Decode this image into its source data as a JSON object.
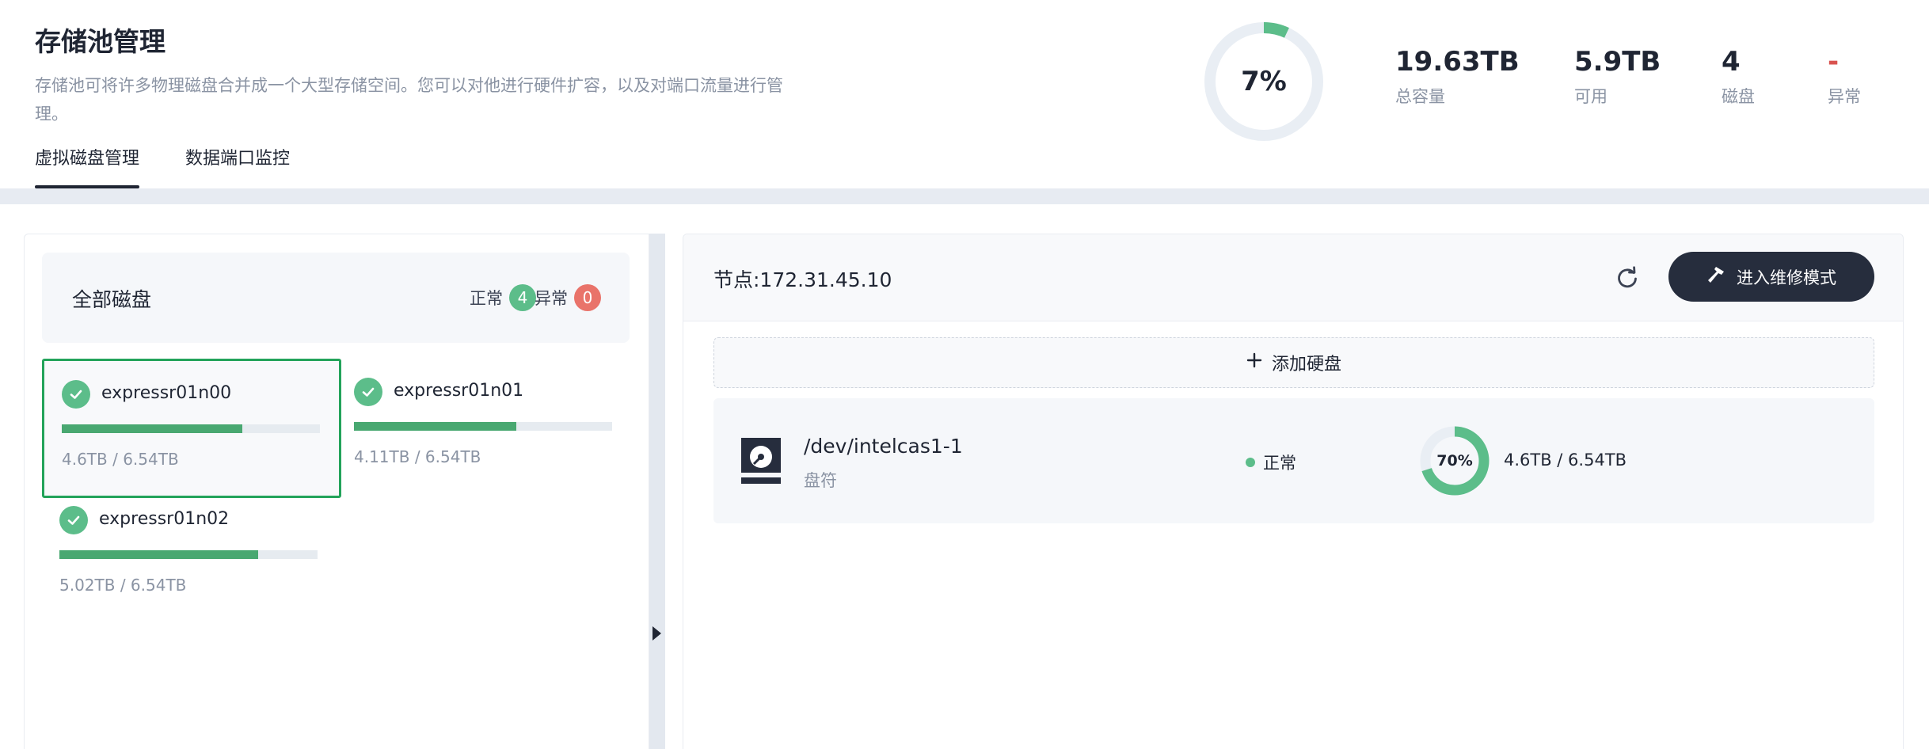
{
  "header": {
    "title": "存储池管理",
    "description": "存储池可将许多物理磁盘合并成一个大型存储空间。您可以对他进行硬件扩容，以及对端口流量进行管理。",
    "tabs": [
      {
        "label": "虚拟磁盘管理",
        "active": true
      },
      {
        "label": "数据端口监控",
        "active": false
      }
    ]
  },
  "summary": {
    "usage_percent_label": "7%",
    "usage_fraction": 0.07,
    "stats": [
      {
        "value": "19.63TB",
        "label": "总容量"
      },
      {
        "value": "5.9TB",
        "label": "可用"
      },
      {
        "value": "4",
        "label": "磁盘"
      },
      {
        "value": "-",
        "label": "异常"
      }
    ]
  },
  "disk_panel": {
    "title": "全部磁盘",
    "normal_label": "正常",
    "normal_count": "4",
    "abnormal_label": "异常",
    "abnormal_count": "0",
    "disks": [
      {
        "name": "expressr01n00",
        "usage": "4.6TB / 6.54TB",
        "fill": 0.7,
        "selected": true
      },
      {
        "name": "expressr01n01",
        "usage": "4.11TB / 6.54TB",
        "fill": 0.63,
        "selected": false
      },
      {
        "name": "expressr01n02",
        "usage": "5.02TB / 6.54TB",
        "fill": 0.77,
        "selected": false
      }
    ]
  },
  "detail_panel": {
    "node_label": "节点:172.31.45.10",
    "maintenance_button": "进入维修模式",
    "add_disk_label": "添加硬盘",
    "devices": [
      {
        "name": "/dev/intelcas1-1",
        "sub_label": "盘符",
        "status": "正常",
        "usage_percent_label": "70%",
        "usage_fraction": 0.7,
        "capacity": "4.6TB / 6.54TB"
      }
    ]
  },
  "colors": {
    "accent_green": "#5cbd8a",
    "bar_green": "#49a871",
    "selected_border": "#23a35a",
    "alert_red": "#e9736a",
    "dark_button": "#262d3d",
    "ring_track": "#e9eef4"
  },
  "icons": {
    "check": "check-circle-icon",
    "refresh": "refresh-icon",
    "hammer": "hammer-icon",
    "plus": "plus-icon",
    "disk": "hard-disk-icon",
    "collapse": "caret-right-icon"
  }
}
